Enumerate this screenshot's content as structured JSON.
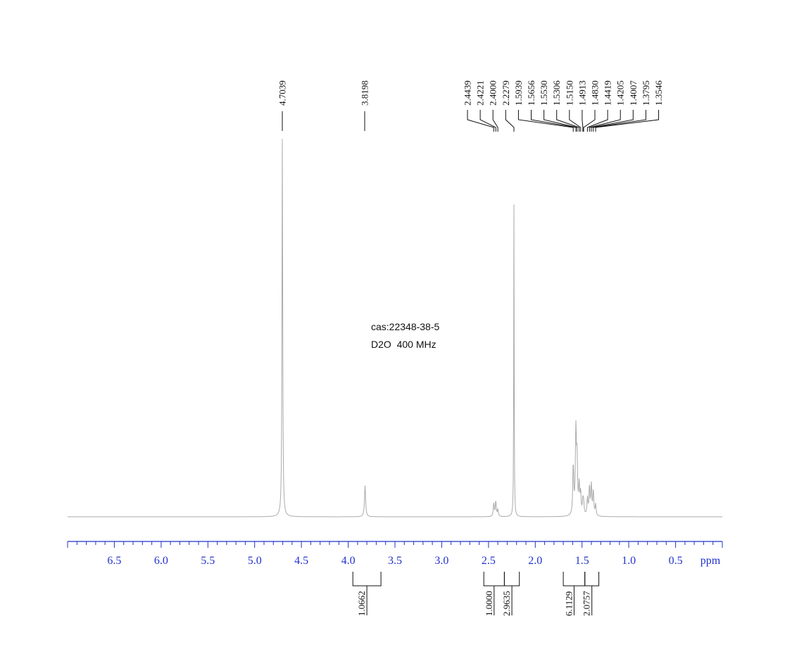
{
  "chart_data": {
    "type": "line",
    "sample_info": [
      "cas:22348-38-5",
      "D2O  400 MHz"
    ],
    "x_axis": {
      "unit": "ppm",
      "range": [
        7.0,
        0.0
      ],
      "reversed": true,
      "tick_labels": [
        "6.5",
        "6.0",
        "5.5",
        "5.0",
        "4.5",
        "4.0",
        "3.5",
        "3.0",
        "2.5",
        "2.0",
        "1.5",
        "1.0",
        "0.5"
      ]
    },
    "grid": false,
    "peak_labels": [
      "4.7039",
      "3.8198",
      "2.4439",
      "2.4221",
      "2.4000",
      "2.2279",
      "1.5939",
      "1.5656",
      "1.5530",
      "1.5306",
      "1.5150",
      "1.4913",
      "1.4830",
      "1.4419",
      "1.4205",
      "1.4007",
      "1.3795",
      "1.3546"
    ],
    "integrals": [
      {
        "from": 3.95,
        "to": 3.65,
        "value": "1.0662"
      },
      {
        "from": 2.55,
        "to": 2.33,
        "value": "1.0000"
      },
      {
        "from": 2.33,
        "to": 2.17,
        "value": "2.9635"
      },
      {
        "from": 1.7,
        "to": 1.47,
        "value": "6.1129"
      },
      {
        "from": 1.47,
        "to": 1.32,
        "value": "2.0757"
      }
    ],
    "signals": [
      {
        "shift": 4.7039,
        "height": 1.0,
        "width": 0.0045
      },
      {
        "shift": 3.8198,
        "height": 0.082,
        "width": 0.007
      },
      {
        "shift": 2.4439,
        "height": 0.035,
        "width": 0.006
      },
      {
        "shift": 2.4221,
        "height": 0.04,
        "width": 0.006
      },
      {
        "shift": 2.4,
        "height": 0.018,
        "width": 0.006
      },
      {
        "shift": 2.2279,
        "height": 0.82,
        "width": 0.0028
      },
      {
        "shift": 1.5939,
        "height": 0.13,
        "width": 0.006
      },
      {
        "shift": 1.5656,
        "height": 0.22,
        "width": 0.007
      },
      {
        "shift": 1.553,
        "height": 0.13,
        "width": 0.006
      },
      {
        "shift": 1.5306,
        "height": 0.075,
        "width": 0.006
      },
      {
        "shift": 1.515,
        "height": 0.055,
        "width": 0.006
      },
      {
        "shift": 1.4913,
        "height": 0.035,
        "width": 0.006
      },
      {
        "shift": 1.483,
        "height": 0.03,
        "width": 0.006
      },
      {
        "shift": 1.4419,
        "height": 0.045,
        "width": 0.006
      },
      {
        "shift": 1.4205,
        "height": 0.075,
        "width": 0.006
      },
      {
        "shift": 1.4007,
        "height": 0.08,
        "width": 0.006
      },
      {
        "shift": 1.3795,
        "height": 0.065,
        "width": 0.006
      },
      {
        "shift": 1.3546,
        "height": 0.03,
        "width": 0.006
      }
    ],
    "colors": {
      "spectrum": "#aaaaaa",
      "axis": "#2233cc",
      "annotation": "#111111"
    }
  }
}
